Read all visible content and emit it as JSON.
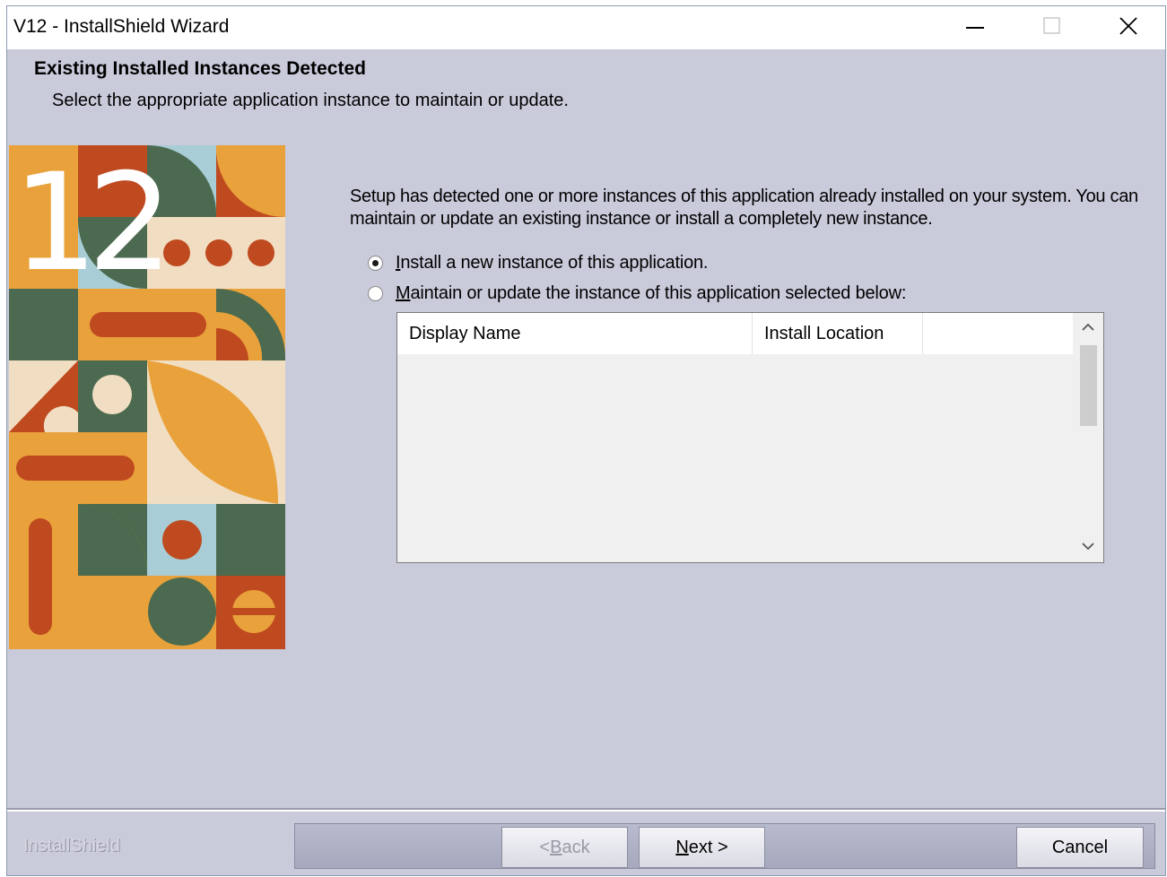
{
  "window": {
    "title": "V12 - InstallShield Wizard",
    "controls": [
      "minimize-icon",
      "maximize-icon",
      "close-icon"
    ]
  },
  "header": {
    "title": "Existing Installed Instances Detected",
    "subtitle": "Select the appropriate application instance to maintain or update."
  },
  "art": {
    "label": "12"
  },
  "body": {
    "description": "Setup has detected one or more instances of this application already installed on your system. You can maintain or update an existing instance or install a completely new instance."
  },
  "options": [
    {
      "mnemonic": "I",
      "rest": "nstall a new instance of this application.",
      "selected": true
    },
    {
      "mnemonic": "M",
      "rest": "aintain or update the instance of this application selected below:",
      "selected": false
    }
  ],
  "instances_table": {
    "columns": [
      "Display Name",
      "Install Location"
    ],
    "rows": []
  },
  "footer": {
    "brand": "InstallShield",
    "back": {
      "prefix": "< ",
      "mnemonic": "B",
      "rest": "ack",
      "enabled": false
    },
    "next": {
      "prefix": "",
      "mnemonic": "N",
      "rest": "ext >",
      "enabled": true
    },
    "cancel": {
      "label": "Cancel",
      "enabled": true
    }
  },
  "colors": {
    "dialog_bg": "#c9cbdb",
    "art_orange": "#e9a23b",
    "art_rust": "#bf4a1f",
    "art_green": "#4b6a4f",
    "art_blue": "#a9cdd6",
    "art_cream": "#f1ddc2"
  }
}
